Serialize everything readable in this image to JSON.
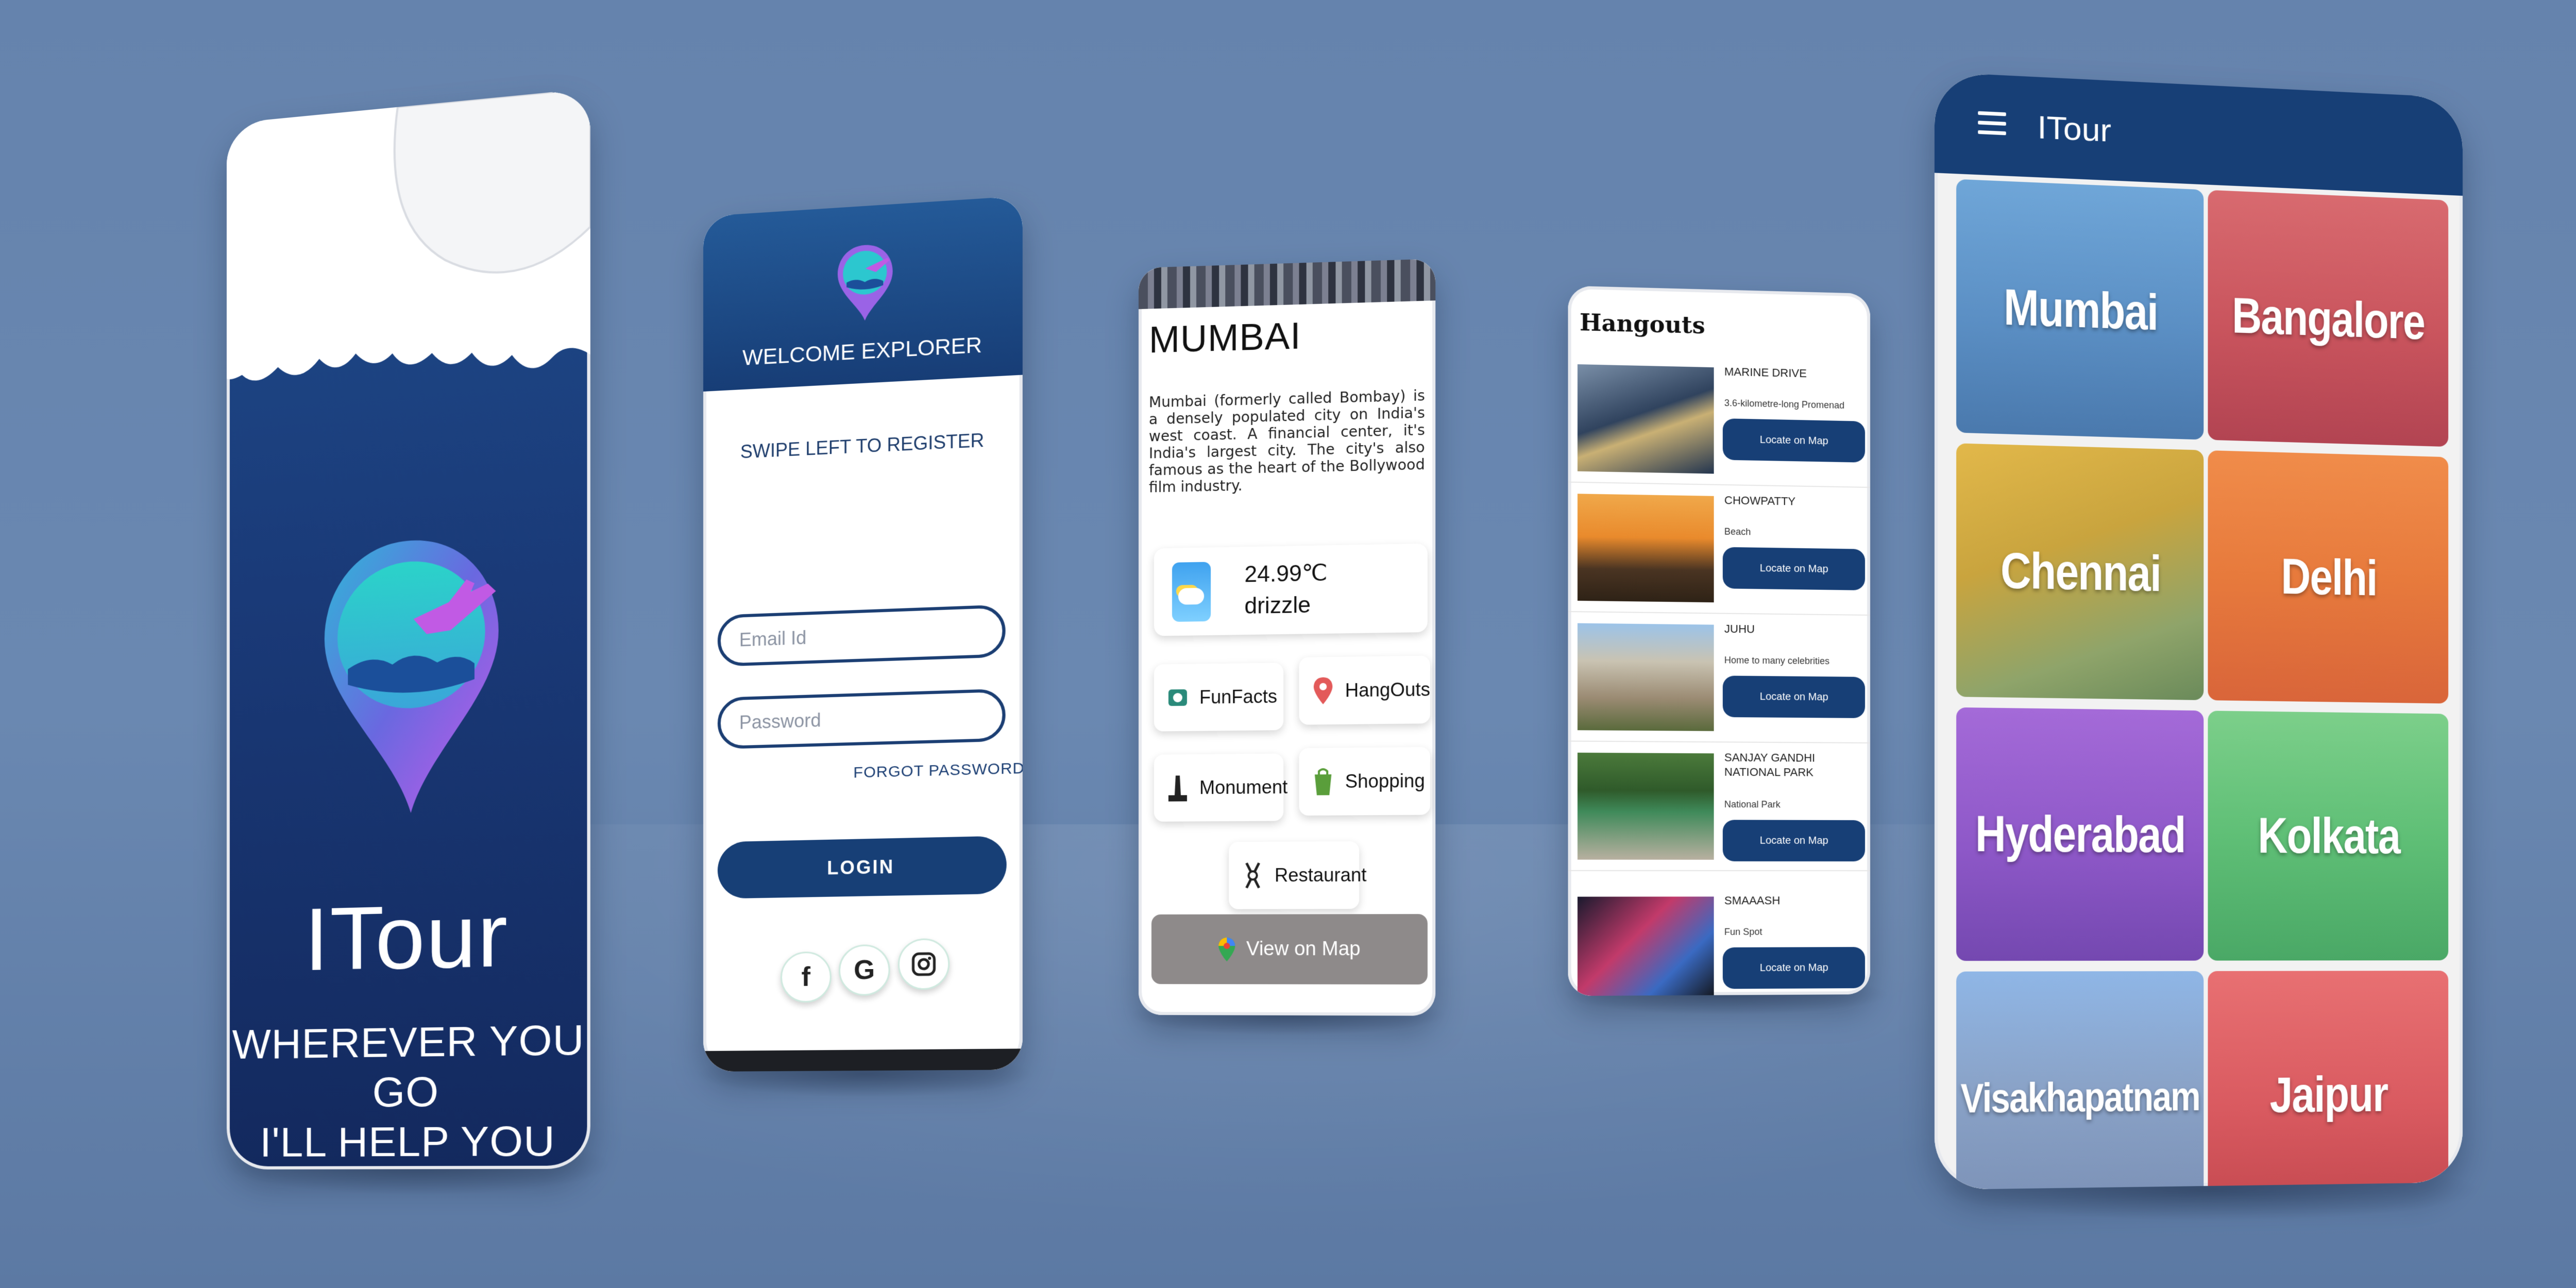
{
  "splash": {
    "title": "ITour",
    "tagline_line1": "WHEREVER YOU GO",
    "tagline_line2": "I'LL HELP YOU"
  },
  "login": {
    "welcome": "WELCOME EXPLORER",
    "swipe_hint": "SWIPE LEFT TO REGISTER",
    "email_placeholder": "Email Id",
    "password_placeholder": "Password",
    "forgot": "FORGOT PASSWORD",
    "login_button": "LOGIN",
    "social": [
      "f",
      "G",
      "instagram"
    ]
  },
  "city_detail": {
    "city": "MUMBAI",
    "description": "Mumbai (formerly called Bombay) is a densely populated city on India's west coast. A financial center, it's India's largest city. The city's also famous as the heart of the Bollywood film industry.",
    "temperature": "24.99℃",
    "condition": "drizzle",
    "buttons": {
      "funfacts": "FunFacts",
      "hangouts": "HangOuts",
      "monument": "Monument",
      "shopping": "Shopping",
      "restaurant": "Restaurant"
    },
    "map_button": "View on Map"
  },
  "hangouts": {
    "title": "Hangouts",
    "locate_label": "Locate on Map",
    "items": [
      {
        "name": "MARINE DRIVE",
        "subtitle": "3.6-kilometre-long Promenad"
      },
      {
        "name": "CHOWPATTY",
        "subtitle": "Beach"
      },
      {
        "name": "JUHU",
        "subtitle": "Home to many celebrities"
      },
      {
        "name": "SANJAY GANDHI NATIONAL PARK",
        "subtitle": "National Park"
      },
      {
        "name": "SMAAASH",
        "subtitle": "Fun Spot"
      }
    ]
  },
  "city_grid": {
    "app_title": "ITour",
    "cities": [
      "Mumbai",
      "Bangalore",
      "Chennai",
      "Delhi",
      "Hyderabad",
      "Kolkata",
      "Visakhapatnam",
      "Jaipur"
    ]
  },
  "colors": {
    "brand_blue": "#173f76",
    "background": "#6583ad"
  }
}
